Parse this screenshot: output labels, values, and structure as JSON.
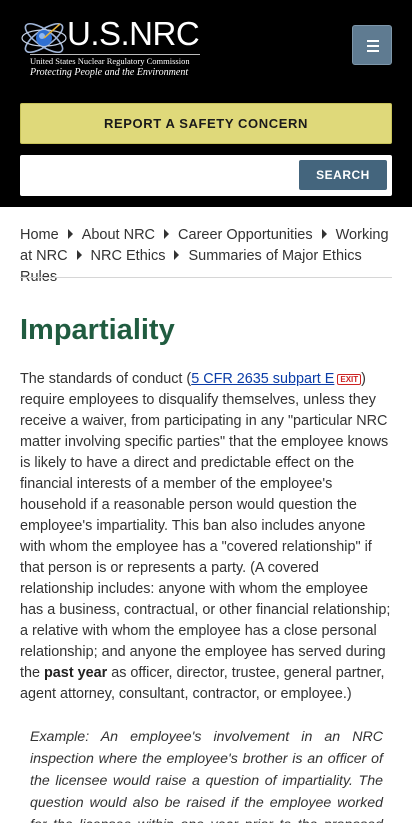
{
  "header": {
    "logo": {
      "name": "U.S.NRC",
      "org": "United States Nuclear Regulatory Commission",
      "tagline": "Protecting People and the Environment"
    },
    "menu_icon": "hamburger-menu-icon",
    "report_label": "REPORT A SAFETY CONCERN",
    "search": {
      "value": "",
      "placeholder": "",
      "button_label": "SEARCH"
    }
  },
  "breadcrumb": {
    "items": [
      {
        "label": "Home"
      },
      {
        "label": "About NRC"
      },
      {
        "label": "Career Opportunities"
      },
      {
        "label": "Working at NRC"
      },
      {
        "label": "NRC Ethics"
      },
      {
        "label": "Summaries of Major Ethics Rules"
      }
    ]
  },
  "page": {
    "title": "Impartiality",
    "para_start": "The standards of conduct (",
    "link_text": "5 CFR 2635 subpart E",
    "exit_label": "EXIT",
    "para_mid": ") require employees to disqualify themselves, unless they receive a waiver, from participating in any \"particular NRC matter involving specific parties\" that the employee knows is likely to have a direct and predictable effect on the financial interests of a member of the employee's household if a reasonable person would question the employee's impartiality. This ban also includes anyone with whom the employee has a \"covered relationship\" if that person is or represents a party. (A covered relationship includes: anyone with whom the employee has a business, contractual, or other financial relationship; a relative with whom the employee has a close personal relationship; and anyone the employee has served during the ",
    "para_bold": "past year",
    "para_end": " as officer, director, trustee, general partner, agent attorney, consultant, contractor, or employee.)",
    "example": "Example: An employee's involvement in an NRC inspection where the employee's brother is an officer of the licensee would raise a question of impartiality. The question would also be raised if the employee worked for the licensee within one year prior to the proposed inspection."
  },
  "colors": {
    "header_bg": "#000000",
    "report_button": "#dfd97a",
    "search_button": "#44657d",
    "menu_button": "#5f7b91",
    "title": "#205c40",
    "link": "#0b3da8",
    "exit_badge": "#cc2222"
  }
}
